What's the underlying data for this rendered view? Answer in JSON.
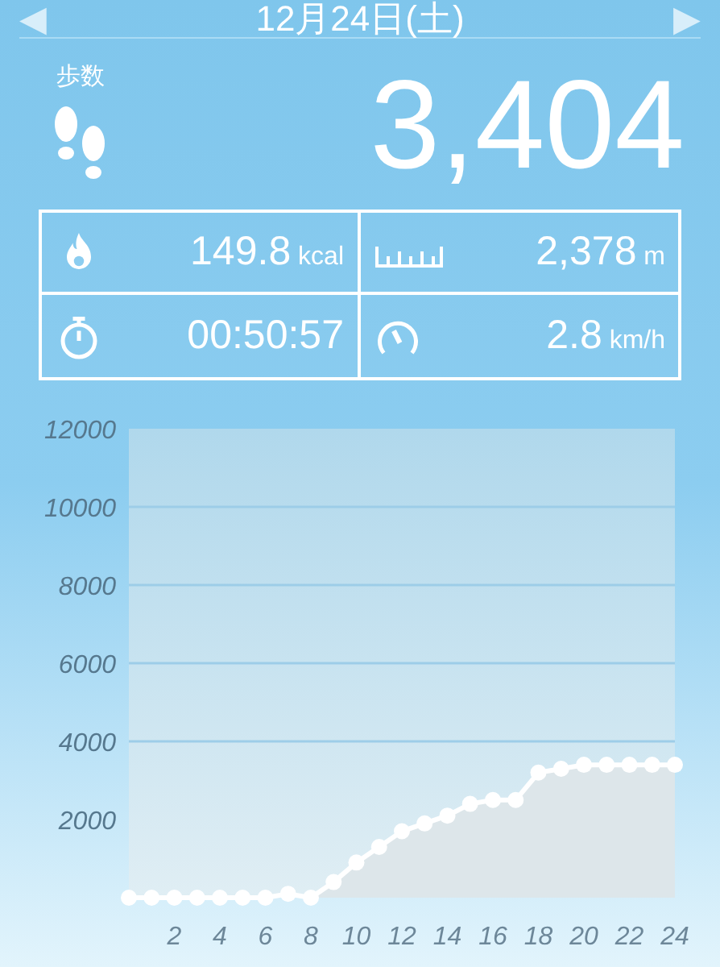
{
  "header": {
    "date": "12月24日(土)",
    "prev": "◀",
    "next": "▶"
  },
  "steps": {
    "label": "歩数",
    "value": "3,404"
  },
  "stats": [
    {
      "kind": "calories",
      "value": "149.8",
      "unit": "kcal"
    },
    {
      "kind": "distance",
      "value": "2,378",
      "unit": "m"
    },
    {
      "kind": "time",
      "value": "00:50:57"
    },
    {
      "kind": "speed",
      "value": "2.8",
      "unit": "km/h"
    }
  ],
  "chart": {
    "chart_data": {
      "type": "area",
      "x": [
        0,
        1,
        2,
        3,
        4,
        5,
        6,
        7,
        8,
        9,
        10,
        11,
        12,
        13,
        14,
        15,
        16,
        17,
        18,
        19,
        20,
        21,
        22,
        23,
        24
      ],
      "ylim": [
        0,
        12000
      ],
      "xlim": [
        0,
        24
      ],
      "yticks": [
        2000,
        4000,
        6000,
        8000,
        10000,
        12000
      ],
      "grid": true,
      "xticks": [
        2,
        4,
        6,
        8,
        10,
        12,
        14,
        16,
        18,
        20,
        22,
        24
      ],
      "series": [
        {
          "color": "#ffffff",
          "values": [
            0,
            0,
            0,
            0,
            0,
            0,
            0,
            100,
            0,
            400,
            900,
            1300,
            1700,
            1900,
            2100,
            2400,
            2500,
            2500,
            3200,
            3300,
            3400,
            3400,
            3400,
            3400,
            3400
          ]
        }
      ]
    }
  }
}
